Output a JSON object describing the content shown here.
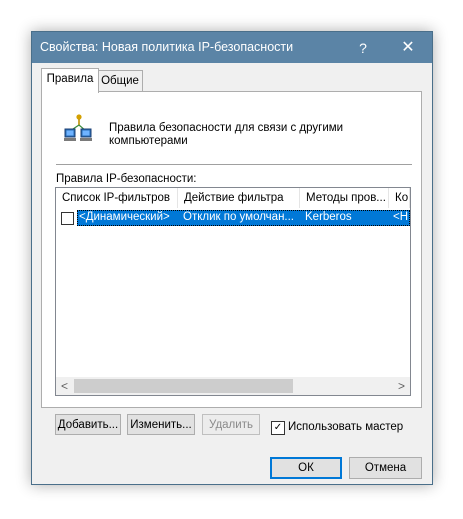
{
  "window": {
    "title": "Свойства: Новая политика IP-безопасности",
    "help_glyph": "?",
    "close_glyph": "✕"
  },
  "tabs": [
    {
      "label": "Правила",
      "active": true
    },
    {
      "label": "Общие",
      "active": false
    }
  ],
  "header": {
    "icon": "network-computers-icon",
    "description": "Правила безопасности для связи с другими компьютерами"
  },
  "rules": {
    "label": "Правила IP-безопасности:",
    "columns": [
      "Список IP-фильтров",
      "Действие фильтра",
      "Методы пров...",
      "Ко"
    ],
    "rows": [
      {
        "checked": false,
        "selected": true,
        "cells": [
          "<Динамический>",
          "Отклик по умолчан...",
          "Kerberos",
          "<Н"
        ]
      }
    ],
    "scroll_left": "<",
    "scroll_right": ">"
  },
  "buttons": {
    "add": "Добавить...",
    "edit": "Изменить...",
    "remove": "Удалить",
    "ok": "ОК",
    "cancel": "Отмена"
  },
  "wizard_checkbox": {
    "label": "Использовать мастер",
    "checked": true,
    "check_glyph": "✓"
  },
  "colors": {
    "titlebar": "#5b84a6",
    "selection": "#0078d7"
  }
}
